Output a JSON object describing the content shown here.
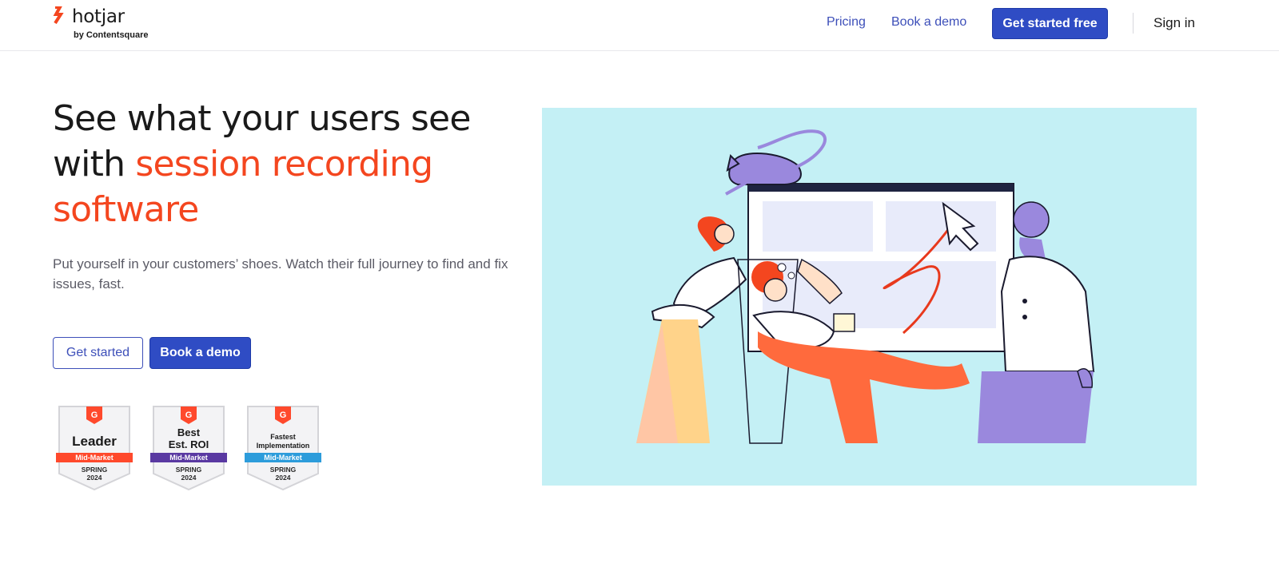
{
  "header": {
    "logo": {
      "name": "hotjar",
      "sub": "by Contentsquare",
      "icon": "hotjar-logo-icon"
    },
    "nav": {
      "pricing": "Pricing",
      "book_demo": "Book a demo",
      "cta": "Get started free",
      "sign_in": "Sign in"
    }
  },
  "hero": {
    "headline_part1": "See what your users see with ",
    "headline_accent": "session recording software",
    "subtext": "Put yourself in your customers’ shoes. Watch their full journey to find and fix issues, fast.",
    "buttons": {
      "get_started": "Get started",
      "book_demo": "Book a demo"
    },
    "illustration": "session-recording-illustration"
  },
  "badges": [
    {
      "title": "Leader",
      "band": "Mid-Market",
      "season": "SPRING",
      "year": "2024",
      "band_color": "#ff492c"
    },
    {
      "title_line1": "Best",
      "title_line2": "Est. ROI",
      "band": "Mid-Market",
      "season": "SPRING",
      "year": "2024",
      "band_color": "#5a39a2"
    },
    {
      "title_line1": "Fastest",
      "title_line2": "Implementation",
      "band": "Mid-Market",
      "season": "SPRING",
      "year": "2024",
      "band_color": "#2d9cdb"
    }
  ],
  "colors": {
    "accent": "#f4461f",
    "primary": "#2f4cc4",
    "link": "#3d4fb9",
    "illustration_bg": "#c4f0f5"
  }
}
